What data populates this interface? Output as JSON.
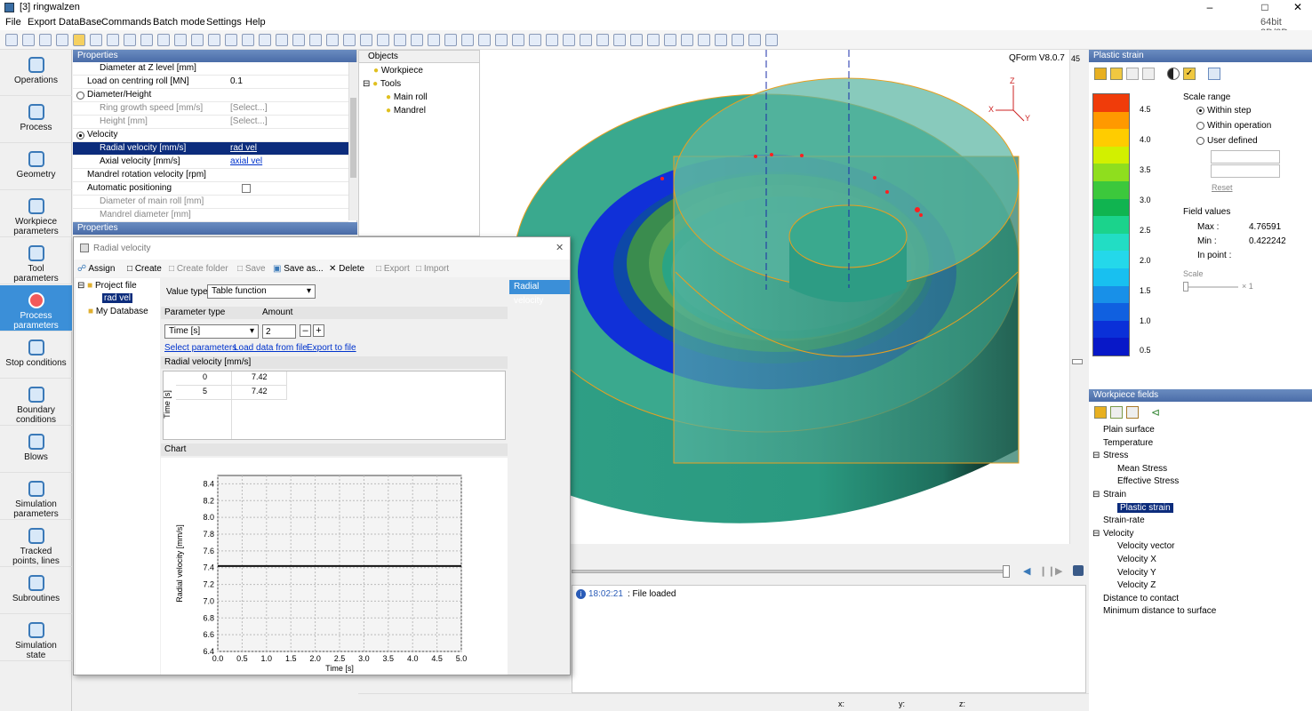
{
  "window": {
    "title": "[3] ringwalzen",
    "arch": "64bit 2D/3D"
  },
  "menu": [
    "File",
    "Export",
    "DataBase",
    "Commands",
    "Batch mode",
    "Settings",
    "Help"
  ],
  "nav": [
    {
      "label1": "Operations",
      "label2": ""
    },
    {
      "label1": "Process",
      "label2": ""
    },
    {
      "label1": "Geometry",
      "label2": ""
    },
    {
      "label1": "Workpiece",
      "label2": "parameters"
    },
    {
      "label1": "Tool",
      "label2": "parameters"
    },
    {
      "label1": "Process parameters",
      "label2": ""
    },
    {
      "label1": "Stop conditions",
      "label2": ""
    },
    {
      "label1": "Boundary",
      "label2": "conditions"
    },
    {
      "label1": "Blows",
      "label2": ""
    },
    {
      "label1": "Simulation",
      "label2": "parameters"
    },
    {
      "label1": "Tracked",
      "label2": "points, lines"
    },
    {
      "label1": "Subroutines",
      "label2": ""
    },
    {
      "label1": "Simulation",
      "label2": "state"
    }
  ],
  "properties": {
    "header": "Properties",
    "footer_header": "Properties",
    "rows": [
      {
        "k": "Diameter at Z level [mm]",
        "v": ""
      },
      {
        "k": "Load on centring roll [MN]",
        "v": "0.1"
      },
      {
        "k": "Diameter/Height",
        "v": ""
      },
      {
        "k": "Ring growth speed [mm/s]",
        "v": "[Select...]"
      },
      {
        "k": "Height [mm]",
        "v": "[Select...]"
      },
      {
        "k": "Velocity",
        "v": ""
      },
      {
        "k": "Radial velocity [mm/s]",
        "v": "rad vel"
      },
      {
        "k": "Axial velocity [mm/s]",
        "v": "axial vel"
      },
      {
        "k": "Mandrel rotation velocity [rpm]",
        "v": ""
      },
      {
        "k": "Automatic positioning",
        "v": ""
      },
      {
        "k": "Diameter of main roll [mm]",
        "v": ""
      },
      {
        "k": "Mandrel diameter [mm]",
        "v": ""
      }
    ]
  },
  "objects": {
    "header": "Objects",
    "items": [
      "Workpiece",
      "Tools",
      "Main roll",
      "Mandrel"
    ]
  },
  "viewport": {
    "version": "QForm V8.0.7",
    "frame": "45",
    "axes": [
      "Z",
      "X",
      "Y"
    ]
  },
  "dialog": {
    "title": "Radial velocity",
    "toolbar": [
      "Assign",
      "Create",
      "Create folder",
      "Save",
      "Save as...",
      "Delete",
      "Export",
      "Import"
    ],
    "tree": [
      "Project file",
      "rad vel",
      "My Database"
    ],
    "right_tab": "Radial velocity",
    "value_type_label": "Value type",
    "value_type": "Table function",
    "param_type_label": "Parameter type",
    "amount_label": "Amount",
    "param_type": "Time [s]",
    "amount": "2",
    "links": [
      "Select parameters",
      "Load data from file",
      "Export to file"
    ],
    "table_title": "Radial velocity [mm/s]",
    "table_axis": "Time [s]",
    "table_rows": [
      {
        "t": "0",
        "v": "7.42"
      },
      {
        "t": "5",
        "v": "7.42"
      }
    ],
    "chart_header": "Chart"
  },
  "chart_data": {
    "type": "line",
    "x": [
      0,
      5
    ],
    "series": [
      {
        "values": [
          7.42,
          7.42
        ]
      }
    ],
    "xlabel": "Time [s]",
    "ylabel": "Radial velocity [mm/s]",
    "xlim": [
      0,
      5
    ],
    "ylim": [
      6.4,
      8.5
    ],
    "xticks": [
      "0.0",
      "0.5",
      "1.0",
      "1.5",
      "2.0",
      "2.5",
      "3.0",
      "3.5",
      "4.0",
      "4.5",
      "5.0"
    ],
    "yticks": [
      "6.4",
      "6.6",
      "6.8",
      "7.0",
      "7.2",
      "7.4",
      "7.6",
      "7.8",
      "8.0",
      "8.2",
      "8.4"
    ],
    "grid": true
  },
  "plastic_strain": {
    "header": "Plastic strain",
    "scale_range_label": "Scale range",
    "options": [
      "Within step",
      "Within operation",
      "User defined"
    ],
    "reset": "Reset",
    "field_values_label": "Field values",
    "max_label": "Max :",
    "max": "4.76591",
    "min_label": "Min :",
    "min": "0.422242",
    "inpoint_label": "In point :",
    "scale_label": "Scale",
    "scale_mult": "× 1",
    "legend": [
      {
        "label": "4.5",
        "color": "#f03c0a"
      },
      {
        "label": "",
        "color": "#ff9900"
      },
      {
        "label": "4.0",
        "color": "#ffcc00"
      },
      {
        "label": "",
        "color": "#d2f000"
      },
      {
        "label": "3.5",
        "color": "#8fde1e"
      },
      {
        "label": "",
        "color": "#3cc83c"
      },
      {
        "label": "3.0",
        "color": "#10b450"
      },
      {
        "label": "",
        "color": "#1bd38c"
      },
      {
        "label": "2.5",
        "color": "#22ddc4"
      },
      {
        "label": "",
        "color": "#24d8ea"
      },
      {
        "label": "2.0",
        "color": "#18c0f0"
      },
      {
        "label": "",
        "color": "#1890e8"
      },
      {
        "label": "1.5",
        "color": "#1060e0"
      },
      {
        "label": "",
        "color": "#0a30d8"
      },
      {
        "label": "1.0",
        "color": "#0818c8"
      },
      {
        "label": "0.5",
        "color": ""
      }
    ]
  },
  "workpiece_fields": {
    "header": "Workpiece fields",
    "items": [
      {
        "label": "Plain surface",
        "level": 0
      },
      {
        "label": "Temperature",
        "level": 0
      },
      {
        "label": "Stress",
        "level": 0
      },
      {
        "label": "Mean Stress",
        "level": 1
      },
      {
        "label": "Effective Stress",
        "level": 1
      },
      {
        "label": "Strain",
        "level": 0
      },
      {
        "label": "Plastic strain",
        "level": 1
      },
      {
        "label": "Strain-rate",
        "level": 0
      },
      {
        "label": "Velocity",
        "level": 0
      },
      {
        "label": "Velocity vector",
        "level": 1
      },
      {
        "label": "Velocity X",
        "level": 1
      },
      {
        "label": "Velocity Y",
        "level": 1
      },
      {
        "label": "Velocity Z",
        "level": 1
      },
      {
        "label": "Distance to contact",
        "level": 0
      },
      {
        "label": "Minimum distance to surface",
        "level": 0
      }
    ]
  },
  "log": {
    "time": "18:02:21",
    "msg": ": File loaded"
  },
  "status": {
    "x": "x:",
    "y": "y:",
    "z": "z:"
  }
}
